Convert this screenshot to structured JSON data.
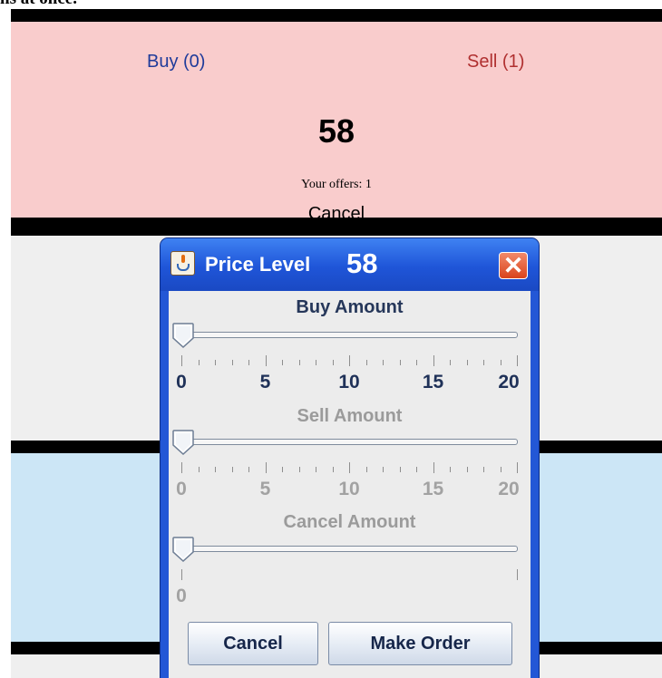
{
  "page": {
    "top_fragment": "ns at once."
  },
  "market": {
    "sell_level": {
      "buy_label": "Buy (0)",
      "sell_label": "Sell (1)",
      "price": "58",
      "your_offers": "Your offers: 1",
      "cancel_label": "Cancel"
    },
    "colors": {
      "sell_band": "#f9cccc",
      "neutral_band": "#efefef",
      "buy_band": "#cce6f6",
      "divider": "#000000"
    }
  },
  "dialog": {
    "title": "Price Level",
    "price": "58",
    "close_glyph": "✕",
    "icon": "java-cup-icon",
    "sliders": [
      {
        "title": "Buy Amount",
        "value": 0,
        "min": 0,
        "max": 20,
        "enabled": true,
        "tick_labels": [
          "0",
          "5",
          "10",
          "15",
          "20"
        ]
      },
      {
        "title": "Sell Amount",
        "value": 0,
        "min": 0,
        "max": 20,
        "enabled": false,
        "tick_labels": [
          "0",
          "5",
          "10",
          "15",
          "20"
        ]
      },
      {
        "title": "Cancel Amount",
        "value": 0,
        "min": 0,
        "max": 1,
        "enabled": false,
        "tick_labels": [
          "0"
        ]
      }
    ],
    "buttons": {
      "cancel_label": "Cancel",
      "make_order_label": "Make Order"
    },
    "colors": {
      "titlebar": "#2357d6",
      "close_button": "#d9431c",
      "active_text": "#1f3158",
      "disabled_text": "#a2a2a2"
    }
  }
}
